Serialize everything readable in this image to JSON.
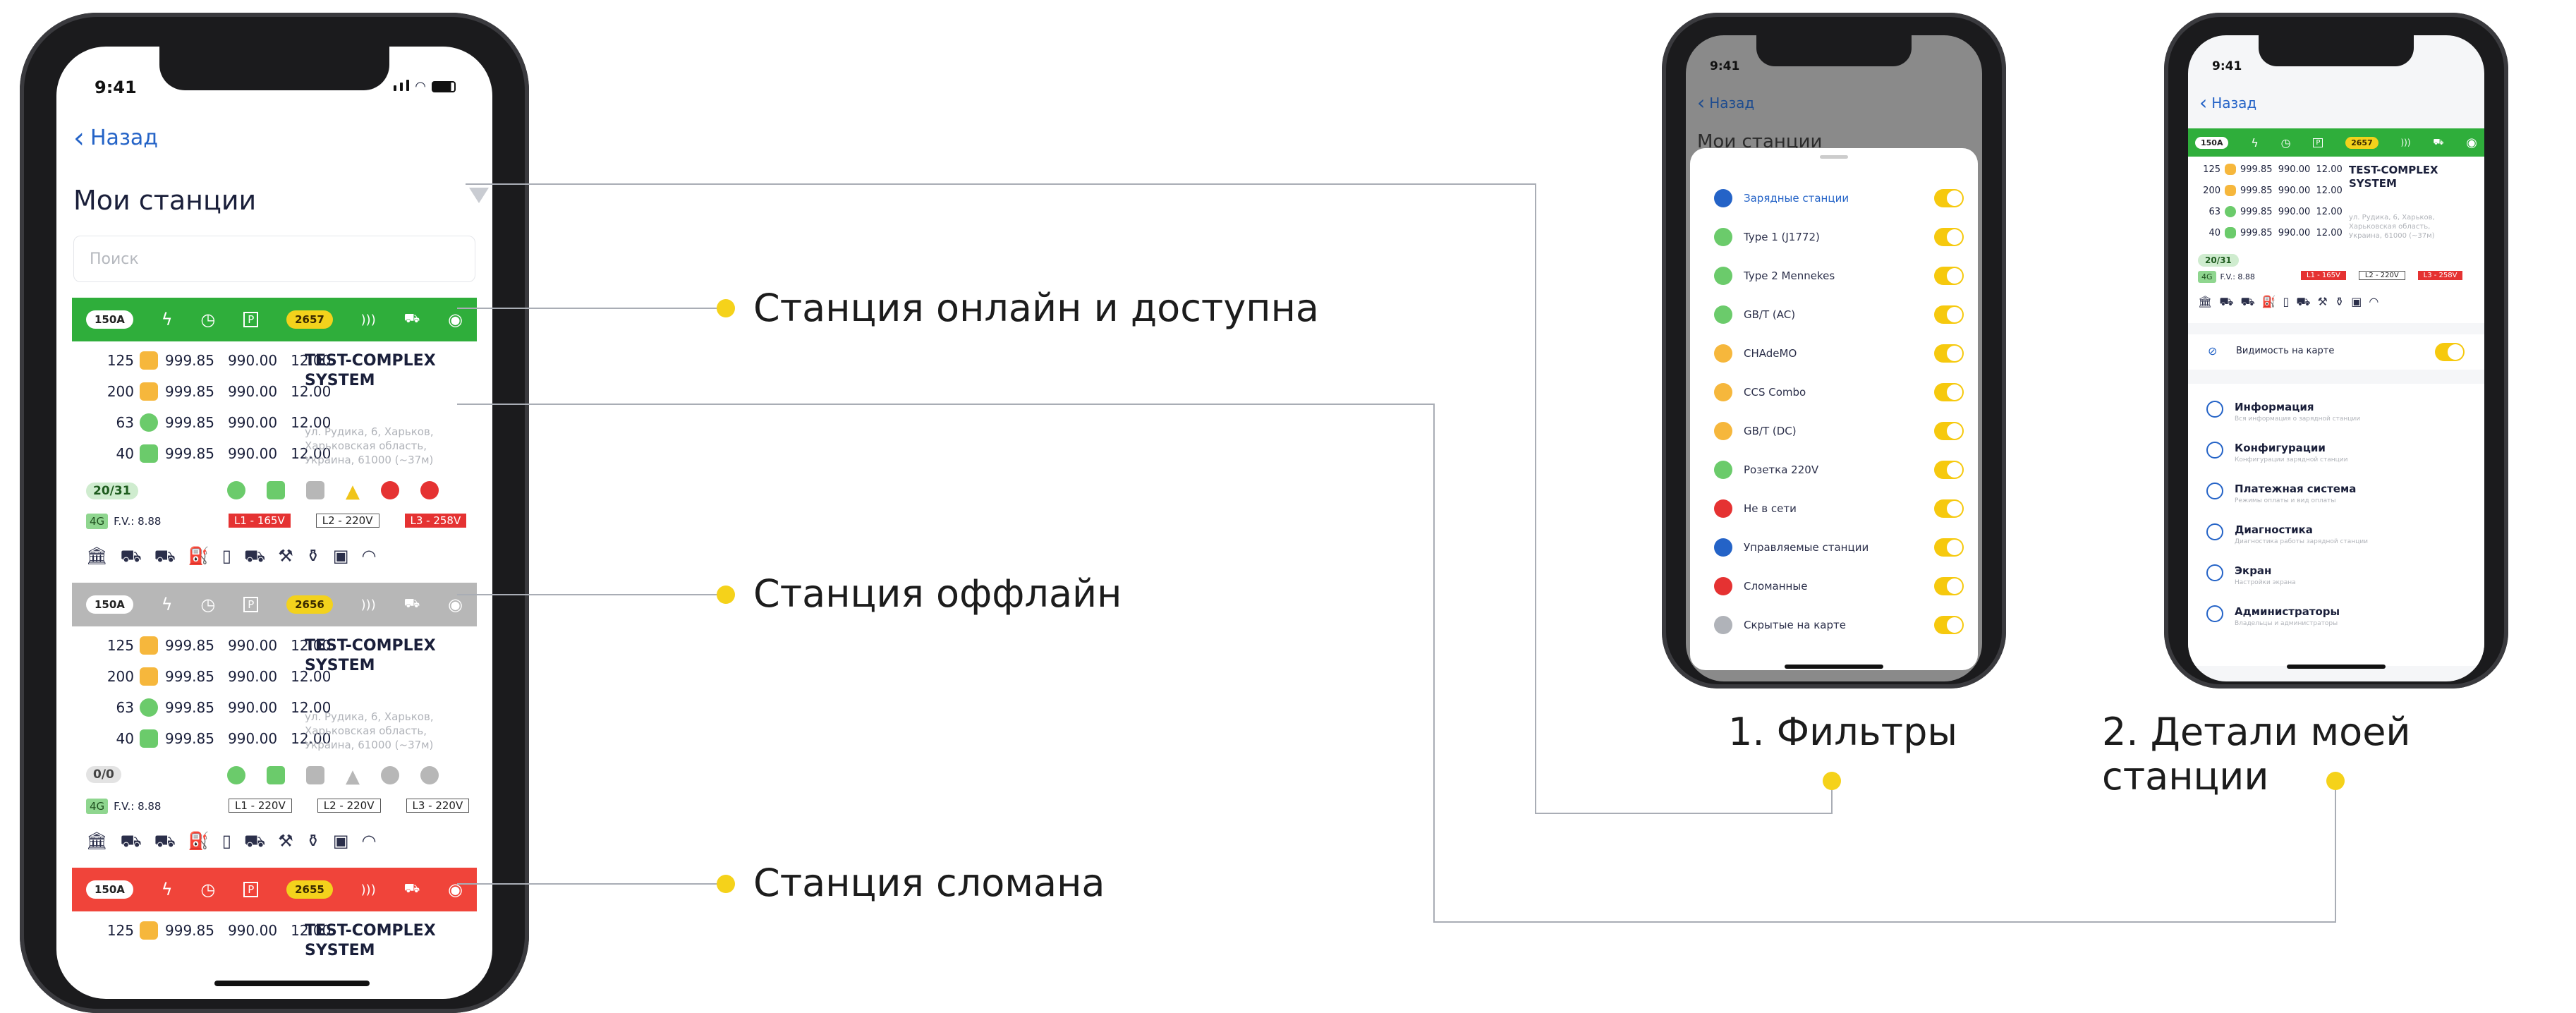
{
  "main_phone": {
    "time": "9:41",
    "back_label": "Назад",
    "title": "Мои станции",
    "search_placeholder": "Поиск",
    "cards": [
      {
        "status": "online",
        "color": "#2fae3b",
        "amp": "150A",
        "id": "2657",
        "rows": [
          {
            "power": "125",
            "a": "999.85",
            "b": "990.00",
            "c": "12.00",
            "plug_color": "#f6b73c"
          },
          {
            "power": "200",
            "a": "999.85",
            "b": "990.00",
            "c": "12.00",
            "plug_color": "#f6b73c"
          },
          {
            "power": "63",
            "a": "999.85",
            "b": "990.00",
            "c": "12.00",
            "plug_color": "#6bcb6b"
          },
          {
            "power": "40",
            "a": "999.85",
            "b": "990.00",
            "c": "12.00",
            "plug_color": "#6bcb6b"
          }
        ],
        "name": "TEST-COMPLEX SYSTEM",
        "address": "ул. Рудика, 6, Харьков, Харьковская область, Украина, 61000 (~37м)",
        "conn": "20/31",
        "tag": "4G",
        "fv": "F.V.: 8.88",
        "l1": "L1 - 165V",
        "l2": "L2 - 220V",
        "l3": "L3 - 258V"
      },
      {
        "status": "offline",
        "color": "#b7b7b7",
        "amp": "150A",
        "id": "2656",
        "rows": [
          {
            "power": "125",
            "a": "999.85",
            "b": "990.00",
            "c": "12.00",
            "plug_color": "#f6b73c"
          },
          {
            "power": "200",
            "a": "999.85",
            "b": "990.00",
            "c": "12.00",
            "plug_color": "#f6b73c"
          },
          {
            "power": "63",
            "a": "999.85",
            "b": "990.00",
            "c": "12.00",
            "plug_color": "#6bcb6b"
          },
          {
            "power": "40",
            "a": "999.85",
            "b": "990.00",
            "c": "12.00",
            "plug_color": "#6bcb6b"
          }
        ],
        "name": "TEST-COMPLEX SYSTEM",
        "address": "ул. Рудика, 6, Харьков, Харьковская область, Украина, 61000 (~37м)",
        "conn": "0/0",
        "tag": "4G",
        "fv": "F.V.: 8.88",
        "l1": "L1 - 220V",
        "l2": "L2 - 220V",
        "l3": "L3 - 220V"
      },
      {
        "status": "broken",
        "color": "#f0443a",
        "amp": "150A",
        "id": "2655",
        "rows": [
          {
            "power": "125",
            "a": "999.85",
            "b": "990.00",
            "c": "12.00",
            "plug_color": "#f6b73c"
          }
        ],
        "name": "TEST-COMPLEX SYSTEM"
      }
    ]
  },
  "callouts": {
    "online": "Станция онлайн и доступна",
    "offline": "Станция оффлайн",
    "broken": "Станция сломана",
    "filters": "1. Фильтры",
    "details": "2. Детали моей станции"
  },
  "filter_phone": {
    "time": "9:41",
    "back_label": "Назад",
    "title": "Мои станции",
    "items": [
      {
        "label": "Зарядные станции",
        "icon_color": "#2463c7"
      },
      {
        "label": "Type 1 (J1772)",
        "icon_color": "#6bcb6b"
      },
      {
        "label": "Type 2 Mennekes",
        "icon_color": "#6bcb6b"
      },
      {
        "label": "GB/T (AC)",
        "icon_color": "#6bcb6b"
      },
      {
        "label": "CHAdeMO",
        "icon_color": "#f6b73c"
      },
      {
        "label": "CCS Combo",
        "icon_color": "#f6b73c"
      },
      {
        "label": "GB/T (DC)",
        "icon_color": "#f6b73c"
      },
      {
        "label": "Розетка 220V",
        "icon_color": "#6bcb6b"
      },
      {
        "label": "Не в сети",
        "icon_color": "#e53232"
      },
      {
        "label": "Управляемые станции",
        "icon_color": "#2463c7"
      },
      {
        "label": "Сломанные",
        "icon_color": "#e53232"
      },
      {
        "label": "Скрытые на карте",
        "icon_color": "#b0b3b9"
      }
    ]
  },
  "detail_phone": {
    "time": "9:41",
    "back_label": "Назад",
    "amp": "150A",
    "id": "2657",
    "rows": [
      {
        "power": "125",
        "a": "999.85",
        "b": "990.00",
        "c": "12.00"
      },
      {
        "power": "200",
        "a": "999.85",
        "b": "990.00",
        "c": "12.00"
      },
      {
        "power": "63",
        "a": "999.85",
        "b": "990.00",
        "c": "12.00"
      },
      {
        "power": "40",
        "a": "999.85",
        "b": "990.00",
        "c": "12.00"
      }
    ],
    "name": "TEST-COMPLEX SYSTEM",
    "address": "ул. Рудика, 6, Харьков, Харьковская область, Украина, 61000 (~37м)",
    "conn": "20/31",
    "tag": "4G",
    "fv": "F.V.: 8.88",
    "l1": "L1 - 165V",
    "l2": "L2 - 220V",
    "l3": "L3 - 258V",
    "visibility_label": "Видимость на карте",
    "menu": [
      {
        "title": "Информация",
        "sub": "Вся информация о зарядной станции"
      },
      {
        "title": "Конфигурации",
        "sub": "Конфигурации зарядной станции"
      },
      {
        "title": "Платежная система",
        "sub": "Режимы оплаты и вид оплаты"
      },
      {
        "title": "Диагностика",
        "sub": "Диагностика работы зарядной станции"
      },
      {
        "title": "Экран",
        "sub": "Настройки экрана"
      },
      {
        "title": "Администраторы",
        "sub": "Владельцы и администраторы"
      }
    ]
  }
}
